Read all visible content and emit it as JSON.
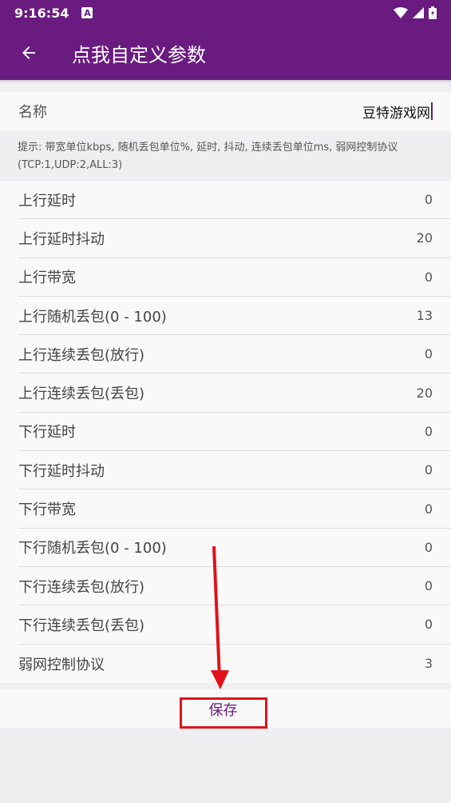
{
  "status_bar": {
    "time": "9:16:54",
    "badge": "A",
    "icons": [
      "wifi-icon",
      "signal-icon",
      "battery-icon"
    ]
  },
  "toolbar": {
    "title": "点我自定义参数",
    "back_icon": "arrow-left-icon"
  },
  "name_field": {
    "label": "名称",
    "value": "豆特游戏网"
  },
  "hint": "提示: 带宽单位kbps, 随机丢包单位%, 延时, 抖动, 连续丢包单位ms, 弱网控制协议(TCP:1,UDP:2,ALL:3)",
  "params": [
    {
      "label": "上行延时",
      "value": "0"
    },
    {
      "label": "上行延时抖动",
      "value": "20"
    },
    {
      "label": "上行带宽",
      "value": "0"
    },
    {
      "label": "上行随机丢包(0 - 100)",
      "value": "13"
    },
    {
      "label": "上行连续丢包(放行)",
      "value": "0"
    },
    {
      "label": "上行连续丢包(丢包)",
      "value": "20"
    },
    {
      "label": "下行延时",
      "value": "0"
    },
    {
      "label": "下行延时抖动",
      "value": "0"
    },
    {
      "label": "下行带宽",
      "value": "0"
    },
    {
      "label": "下行随机丢包(0 - 100)",
      "value": "0"
    },
    {
      "label": "下行连续丢包(放行)",
      "value": "0"
    },
    {
      "label": "下行连续丢包(丢包)",
      "value": "0"
    },
    {
      "label": "弱网控制协议",
      "value": "3"
    }
  ],
  "save": {
    "label": "保存"
  },
  "colors": {
    "primary": "#6a1b80",
    "annotation": "#e0121a",
    "background": "#efeff2"
  }
}
